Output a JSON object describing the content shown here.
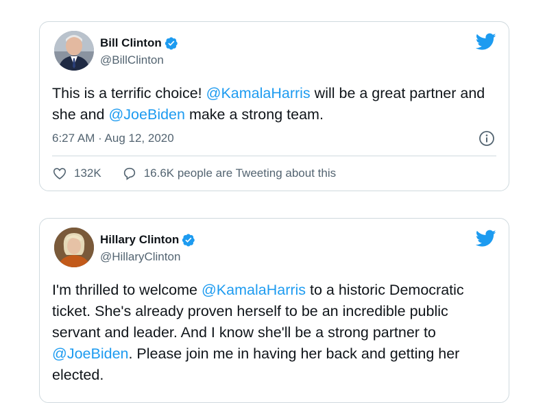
{
  "tweets": [
    {
      "name": "Bill Clinton",
      "handle": "@BillClinton",
      "text_parts": [
        {
          "t": "This is a terrific choice! ",
          "m": false
        },
        {
          "t": "@KamalaHarris",
          "m": true
        },
        {
          "t": " will be a great partner and she and ",
          "m": false
        },
        {
          "t": "@JoeBiden",
          "m": true
        },
        {
          "t": " make a strong team.",
          "m": false
        }
      ],
      "timestamp": "6:27 AM · Aug 12, 2020",
      "likes": "132K",
      "tweeting_about": "16.6K people are Tweeting about this"
    },
    {
      "name": "Hillary Clinton",
      "handle": "@HillaryClinton",
      "text_parts": [
        {
          "t": "I'm thrilled to welcome ",
          "m": false
        },
        {
          "t": "@KamalaHarris",
          "m": true
        },
        {
          "t": " to a historic Democratic ticket. She's already proven herself to be an incredible public servant and leader. And I know she'll be a strong partner to ",
          "m": false
        },
        {
          "t": "@JoeBiden",
          "m": true
        },
        {
          "t": ". Please join me in having her back and getting her elected.",
          "m": false
        }
      ]
    }
  ],
  "colors": {
    "accent": "#1d9bf0",
    "text": "#0f1419",
    "secondary": "#536471",
    "border": "#cfd9de"
  },
  "icons": [
    "verified-badge-icon",
    "twitter-bird-icon",
    "info-icon",
    "heart-icon",
    "speech-bubble-icon"
  ]
}
